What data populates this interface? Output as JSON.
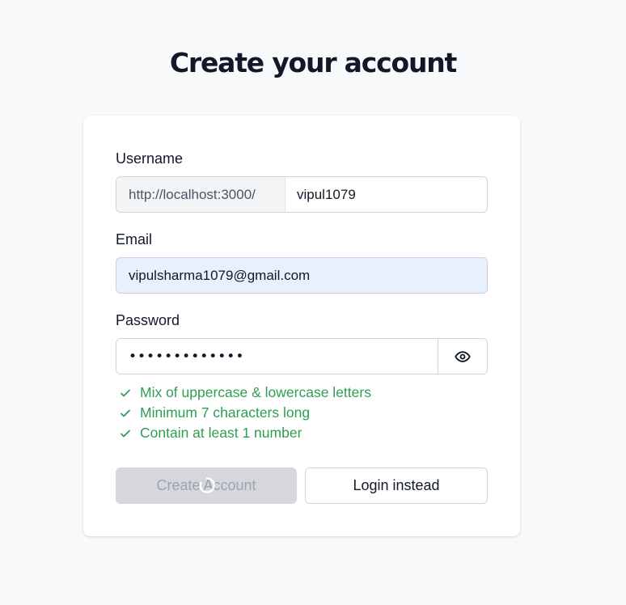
{
  "page": {
    "title": "Create your account"
  },
  "form": {
    "username": {
      "label": "Username",
      "prefix": "http://localhost:3000/",
      "value": "vipul1079"
    },
    "email": {
      "label": "Email",
      "value": "vipulsharma1079@gmail.com"
    },
    "password": {
      "label": "Password",
      "masked_value": "•••••••••••••",
      "toggle_icon": "eye-icon"
    },
    "rules": [
      {
        "text": "Mix of uppercase & lowercase letters",
        "icon": "check-icon"
      },
      {
        "text": "Minimum 7 characters long",
        "icon": "check-icon"
      },
      {
        "text": "Contain at least 1 number",
        "icon": "check-icon"
      }
    ],
    "actions": {
      "create_label": "Create Account",
      "login_label": "Login instead"
    }
  },
  "colors": {
    "background": "#f8f9fb",
    "card": "#ffffff",
    "success": "#2e9e55",
    "autofill": "#e8f0fe",
    "disabled_button": "#d5d7dc"
  }
}
